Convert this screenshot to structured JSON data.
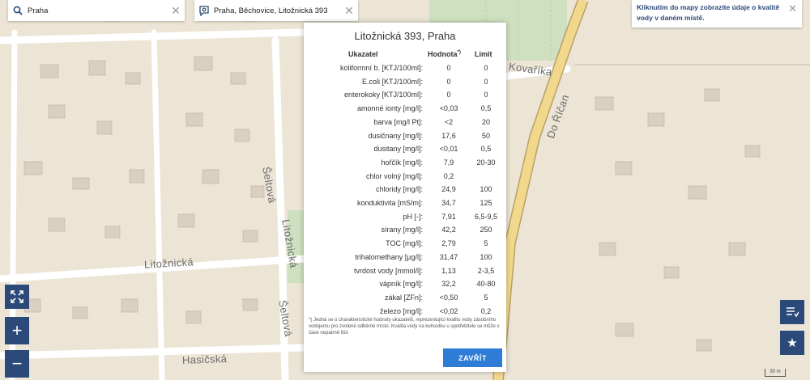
{
  "search": {
    "query": "Praha",
    "address": "Praha, Běchovice, Litožnická 393"
  },
  "info": {
    "text": "Kliknutím do mapy zobrazíte údaje o kvalitě vody v daném místě."
  },
  "map": {
    "streets": {
      "kovarika": "Kovaříka",
      "do_rican": "Do Říčan",
      "seltova": "Šeltová",
      "litoznicka_v": "Litožnická",
      "litoznicka_h": "Litožnická",
      "seltova_b": "Šeltová",
      "hasicska": "Hasičská"
    },
    "scale_label": "30 m"
  },
  "modal": {
    "title": "Litožnická 393, Praha",
    "headers": {
      "indicator": "Ukazatel",
      "value": "Hodnota",
      "value_mark": "*)",
      "limit": "Limit"
    },
    "rows": [
      {
        "name": "koliformní b. [KTJ/100ml]:",
        "value": "0",
        "limit": "0"
      },
      {
        "name": "E.coli [KTJ/100ml]:",
        "value": "0",
        "limit": "0"
      },
      {
        "name": "enterokoky [KTJ/100ml]:",
        "value": "0",
        "limit": "0"
      },
      {
        "name": "amonné ionty [mg/l]:",
        "value": "<0,03",
        "limit": "0,5"
      },
      {
        "name": "barva [mg/l Pt]:",
        "value": "<2",
        "limit": "20"
      },
      {
        "name": "dusičnany [mg/l]:",
        "value": "17,6",
        "limit": "50"
      },
      {
        "name": "dusitany [mg/l]:",
        "value": "<0,01",
        "limit": "0,5"
      },
      {
        "name": "hořčík [mg/l]:",
        "value": "7,9",
        "limit": "20-30"
      },
      {
        "name": "chlor volný [mg/l]:",
        "value": "0,2",
        "limit": ""
      },
      {
        "name": "chloridy [mg/l]:",
        "value": "24,9",
        "limit": "100"
      },
      {
        "name": "konduktivita [mS/m]:",
        "value": "34,7",
        "limit": "125"
      },
      {
        "name": "pH [-]:",
        "value": "7,91",
        "limit": "6,5-9,5"
      },
      {
        "name": "sírany [mg/l]:",
        "value": "42,2",
        "limit": "250"
      },
      {
        "name": "TOC [mg/l]:",
        "value": "2,79",
        "limit": "5"
      },
      {
        "name": "trihalomethany [µg/l]:",
        "value": "31,47",
        "limit": "100"
      },
      {
        "name": "tvrdost vody [mmol/l]:",
        "value": "1,13",
        "limit": "2-3,5"
      },
      {
        "name": "vápník [mg/l]:",
        "value": "32,2",
        "limit": "40-80"
      },
      {
        "name": "zákal [ZFn]:",
        "value": "<0,50",
        "limit": "5"
      },
      {
        "name": "železo [mg/l]:",
        "value": "<0,02",
        "limit": "0,2"
      }
    ],
    "footnote": "*) Jedná se o charakteristické hodnoty ukazatelů, reprezentující kvalitu vody zásobního vodojemu pro zvolené odběrné místo. Kvalita vody na kohoutku u spotřebitele se může v čase nepatrně lišit.",
    "close_label": "ZAVŘÍT"
  },
  "controls": {
    "zoom_in": "+",
    "zoom_out": "−"
  },
  "colors": {
    "accent": "#2b4a7a",
    "button": "#2e7cd6",
    "road_yellow": "#f2d88c"
  }
}
